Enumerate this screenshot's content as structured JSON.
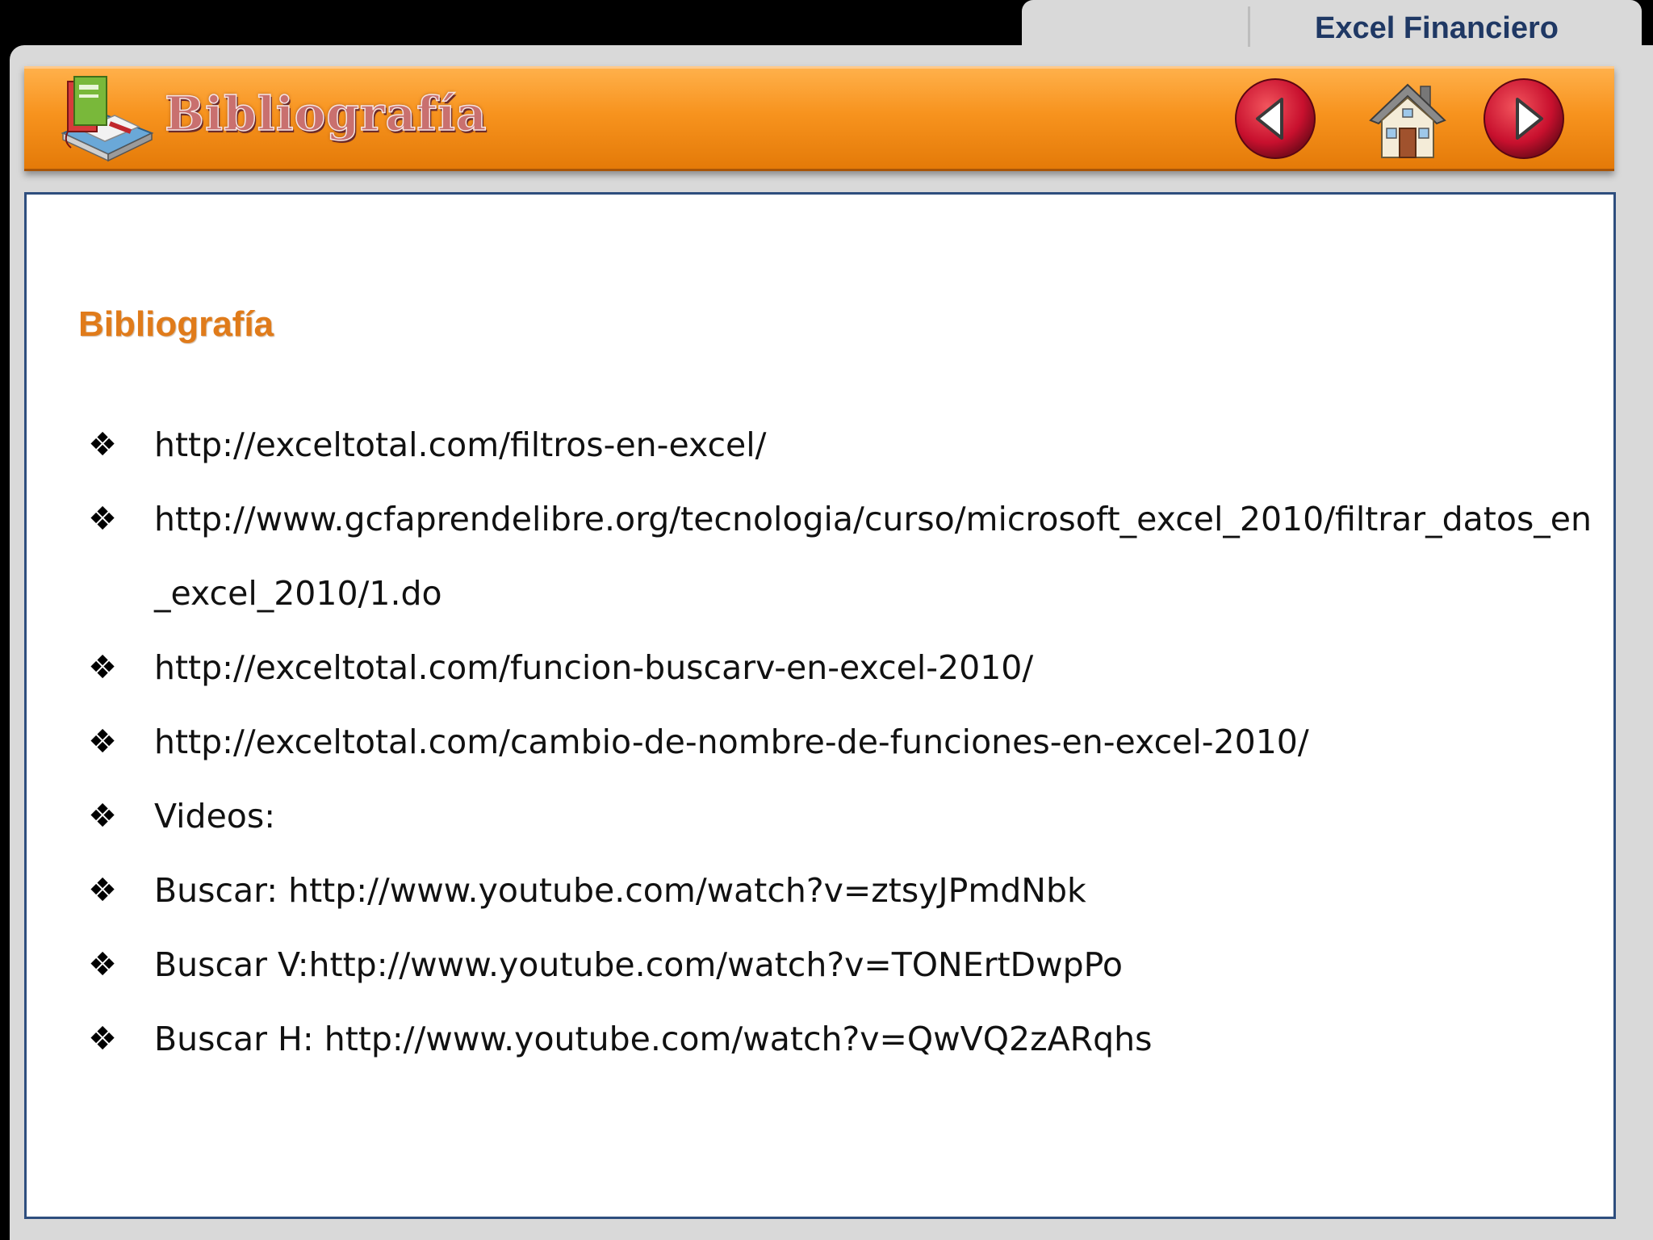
{
  "tab": {
    "title": "Excel Financiero"
  },
  "header": {
    "title": "Bibliografía",
    "icons": {
      "logo": "book-stack-icon",
      "prev": "arrow-left-icon",
      "home": "house-icon",
      "next": "arrow-right-icon"
    },
    "colors": {
      "bar": "#f7931e",
      "nav_button": "#c8102e"
    }
  },
  "content": {
    "heading": "Bibliografía",
    "bullet_glyph": "❖",
    "items": [
      "http://exceltotal.com/filtros-en-excel/",
      "http://www.gcfaprendelibre.org/tecnologia/curso/microsoft_excel_2010/filtrar_datos_en_excel_2010/1.do",
      "http://exceltotal.com/funcion-buscarv-en-excel-2010/",
      "http://exceltotal.com/cambio-de-nombre-de-funciones-en-excel-2010/",
      "Videos:",
      "Buscar: http://www.youtube.com/watch?v=ztsyJPmdNbk",
      "Buscar V:http://www.youtube.com/watch?v=TONErtDwpPo",
      "Buscar H: http://www.youtube.com/watch?v=QwVQ2zARqhs"
    ]
  }
}
